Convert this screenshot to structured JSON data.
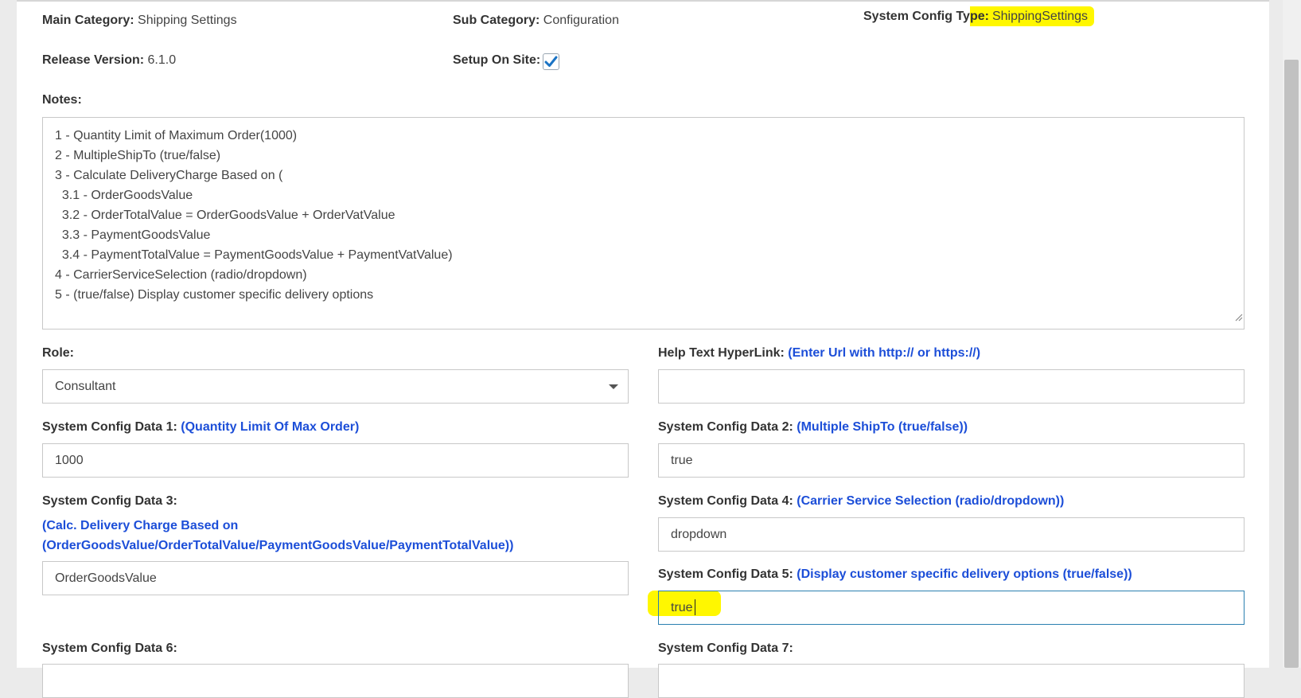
{
  "header": {
    "main_category_label": "Main Category:",
    "main_category_value": "Shipping Settings",
    "sub_category_label": "Sub Category:",
    "sub_category_value": "Configuration",
    "system_config_type_label_plain": "System Config Ty",
    "system_config_type_label_highlight": "pe:",
    "system_config_type_value": "ShippingSettings",
    "release_version_label": "Release Version:",
    "release_version_value": "6.1.0",
    "setup_on_site_label": "Setup On Site:",
    "setup_on_site_checked": true
  },
  "notes": {
    "label": "Notes:",
    "lines": [
      "1 - Quantity Limit of Maximum Order(1000)",
      "2 - MultipleShipTo (true/false)",
      "3 - Calculate DeliveryCharge Based on (",
      "  3.1 - OrderGoodsValue",
      "  3.2 - OrderTotalValue = OrderGoodsValue + OrderVatValue",
      "  3.3 - PaymentGoodsValue",
      "  3.4 - PaymentTotalValue = PaymentGoodsValue + PaymentVatValue)",
      "4 - CarrierServiceSelection (radio/dropdown)",
      "5 - (true/false) Display customer specific delivery options"
    ]
  },
  "role": {
    "label": "Role:",
    "selected": "Consultant"
  },
  "help_link": {
    "label": "Help Text HyperLink:",
    "hint": "(Enter Url with http:// or https://)",
    "value": ""
  },
  "config": {
    "d1": {
      "label": "System Config Data 1:",
      "hint": "(Quantity Limit Of Max Order)",
      "value": "1000"
    },
    "d2": {
      "label": "System Config Data 2:",
      "hint": "(Multiple ShipTo (true/false))",
      "value": "true"
    },
    "d3": {
      "label": "System Config Data 3:",
      "hint_line1": "(Calc. Delivery Charge Based on",
      "hint_line2": "(OrderGoodsValue/OrderTotalValue/PaymentGoodsValue/PaymentTotalValue))",
      "value": "OrderGoodsValue"
    },
    "d4": {
      "label": "System Config Data 4:",
      "hint": "(Carrier Service Selection (radio/dropdown))",
      "value": "dropdown"
    },
    "d5": {
      "label": "System Config Data 5:",
      "hint": "(Display customer specific delivery options (true/false))",
      "value": "true"
    },
    "d6": {
      "label": "System Config Data 6:"
    },
    "d7": {
      "label": "System Config Data 7:"
    }
  },
  "colors": {
    "hint_blue": "#1c4ed8",
    "highlight_yellow": "#fff700",
    "checkbox_check": "#1a73c4"
  }
}
